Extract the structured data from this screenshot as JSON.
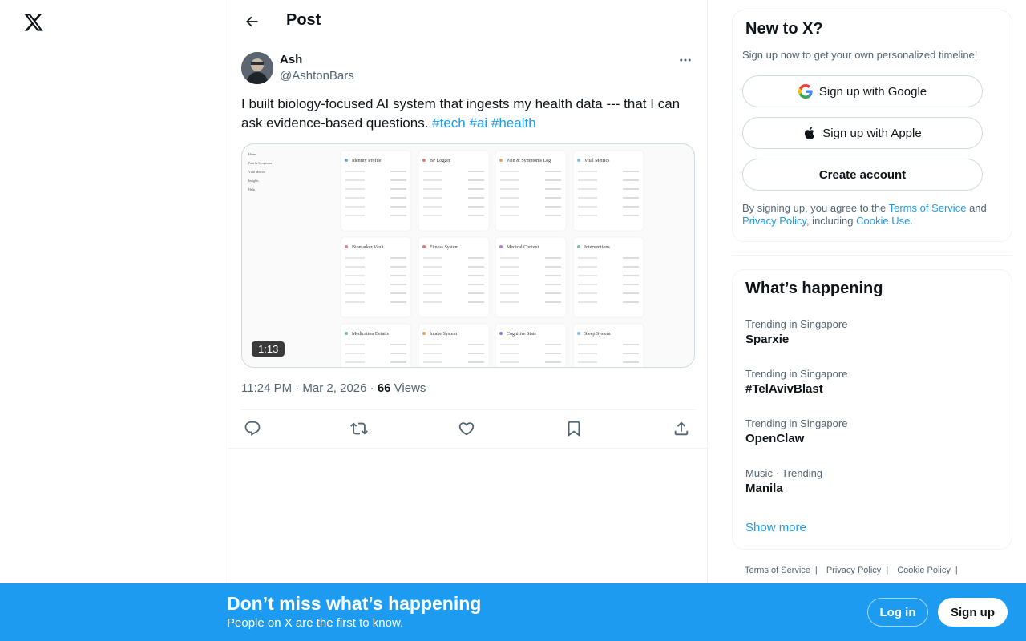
{
  "colors": {
    "accent": "#1d9bf0",
    "text_primary": "#0f1419",
    "text_secondary": "#536471",
    "border": "#eff3f4"
  },
  "nav": {
    "logo_icon": "x-logo-icon"
  },
  "header": {
    "title": "Post",
    "back_icon": "arrow-left-icon"
  },
  "post": {
    "author_name": "Ash",
    "author_handle": "@AshtonBars",
    "text": "I built biology-focused AI system that ingests my health data --- that I can ask evidence-based questions.",
    "hashtags": [
      "#tech",
      "#ai",
      "#health"
    ],
    "video_duration": "1:13",
    "timestamp": "11:24 PM · Mar 2, 2026",
    "views_count": "66",
    "views_label": "Views",
    "more_icon": "more-dots-icon"
  },
  "video_preview": {
    "sidebar": [
      "Home",
      "Pain & Symptoms",
      "Vital Metrics",
      "Insights",
      "Help"
    ],
    "cards": [
      "Identity Profile",
      "BP Logger",
      "Pain & Symptoms Log",
      "Vital Metrics",
      "Biomarker Vault",
      "Fitness System",
      "Medical Context",
      "Interventions",
      "Medication Details",
      "Intake System",
      "Cognitive State",
      "Sleep System"
    ]
  },
  "actions": [
    {
      "name": "reply",
      "icon": "reply-icon"
    },
    {
      "name": "repost",
      "icon": "repost-icon"
    },
    {
      "name": "like",
      "icon": "heart-icon"
    },
    {
      "name": "bookmark",
      "icon": "bookmark-icon"
    },
    {
      "name": "share",
      "icon": "share-icon"
    }
  ],
  "signup": {
    "title": "New to X?",
    "subtitle": "Sign up now to get your own personalized timeline!",
    "google_label": "Sign up with Google",
    "apple_label": "Sign up with Apple",
    "create_label": "Create account",
    "terms_prefix": "By signing up, you agree to the",
    "terms_link": "Terms of Service",
    "terms_and": "and",
    "privacy_link": "Privacy Policy",
    "terms_including": ", including",
    "cookie_link": "Cookie Use."
  },
  "trends": {
    "title": "What’s happening",
    "items": [
      {
        "meta": "Trending in Singapore",
        "name": "Sparxie"
      },
      {
        "meta": "Trending in Singapore",
        "name": "#TelAvivBlast"
      },
      {
        "meta": "Trending in Singapore",
        "name": "OpenClaw"
      },
      {
        "meta": "Music · Trending",
        "name": "Manila"
      }
    ],
    "show_more": "Show more"
  },
  "footer": {
    "links": [
      "Terms of Service",
      "Privacy Policy",
      "Cookie Policy"
    ]
  },
  "bottom_bar": {
    "title": "Don’t miss what’s happening",
    "subtitle": "People on X are the first to know.",
    "login_label": "Log in",
    "signup_label": "Sign up"
  }
}
